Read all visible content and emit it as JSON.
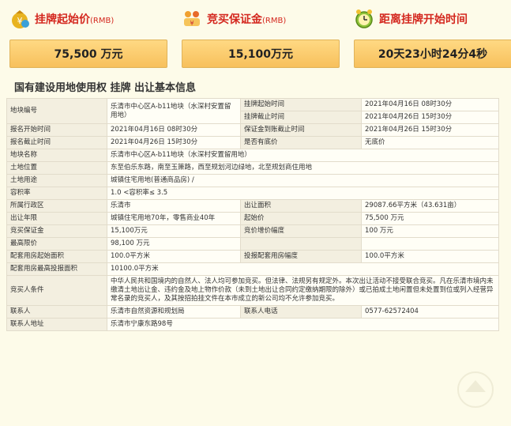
{
  "stats": [
    {
      "label": "挂牌起始价",
      "unit": "(RMB)",
      "value": "75,500 万元",
      "icon": "money-bag-icon"
    },
    {
      "label": "竞买保证金",
      "unit": "(RMB)",
      "value": "15,100万元",
      "icon": "people-coins-icon"
    },
    {
      "label": "距离挂牌开始时间",
      "unit": "",
      "value": "20天23小时24分4秒",
      "icon": "alarm-clock-icon"
    }
  ],
  "section_title": "国有建设用地使用权 挂牌 出让基本信息",
  "rows": {
    "r1": {
      "k1": "地块编号",
      "v1": "乐清市中心区A-b11地块（水深村安置留用地）",
      "k2a": "挂牌起始时间",
      "v2a": "2021年04月16日 08时30分",
      "k2b": "挂牌截止时间",
      "v2b": "2021年04月26日 15时30分"
    },
    "r2": {
      "k1": "报名开始时间",
      "v1": "2021年04月16日 08时30分",
      "k2": "保证金到账截止时间",
      "v2": "2021年04月26日 15时30分"
    },
    "r3": {
      "k1": "报名截止时间",
      "v1": "2021年04月26日 15时30分",
      "k2": "是否有底价",
      "v2": "无底价"
    },
    "r4": {
      "k1": "地块名称",
      "v1": "乐清市中心区A-b11地块（水深村安置留用地）"
    },
    "r5": {
      "k1": "土地位置",
      "v1": "东至伯乐东路，南至玉箫路，西至规划河边绿地，北至规划商住用地"
    },
    "r6": {
      "k1": "土地用途",
      "v1": "城镇住宅用地(普通商品房) /"
    },
    "r7": {
      "k1": "容积率",
      "v1": "1.0 <容积率≤ 3.5"
    },
    "r8": {
      "k1": "所属行政区",
      "v1": "乐清市",
      "k2": "出让面积",
      "v2": "29087.66平方米（43.631亩）"
    },
    "r9": {
      "k1": "出让年限",
      "v1": "城镇住宅用地70年，零售商业40年",
      "k2": "起始价",
      "v2": "75,500 万元"
    },
    "r10": {
      "k1": "竞买保证金",
      "v1": "15,100万元",
      "k2": "竞价增价幅度",
      "v2": "100 万元"
    },
    "r11": {
      "k1": "最高限价",
      "v1": "98,100 万元"
    },
    "r12": {
      "k1": "配套用房起始面积",
      "v1": "100.0平方米",
      "k2": "投报配套用房幅度",
      "v2": "100.0平方米"
    },
    "r13": {
      "k1": "配套用房最高投报面积",
      "v1": "10100.0平方米"
    },
    "r14": {
      "k1": "竞买人条件",
      "v1": "中华人民共和国境内的自然人、法人均可参加竞买。但法律、法规另有规定外。本次出让活动不接受联合竞买。凡在乐清市境内未缴清土地出让金、违约金及地上物作价款（未到土地出让合同约定缴纳期限的除外）或已拍成土地闲置但未处置到位或列入经营异常名录的竞买人，及其按招拍挂文件在本市成立的新公司均不允许参加竞买。"
    },
    "r15": {
      "k1": "联系人",
      "v1": "乐清市自然资源和规划局",
      "k2": "联系人电话",
      "v2": "0577-62572404"
    },
    "r16": {
      "k1": "联系人地址",
      "v1": "乐清市宁康东路98号"
    }
  }
}
